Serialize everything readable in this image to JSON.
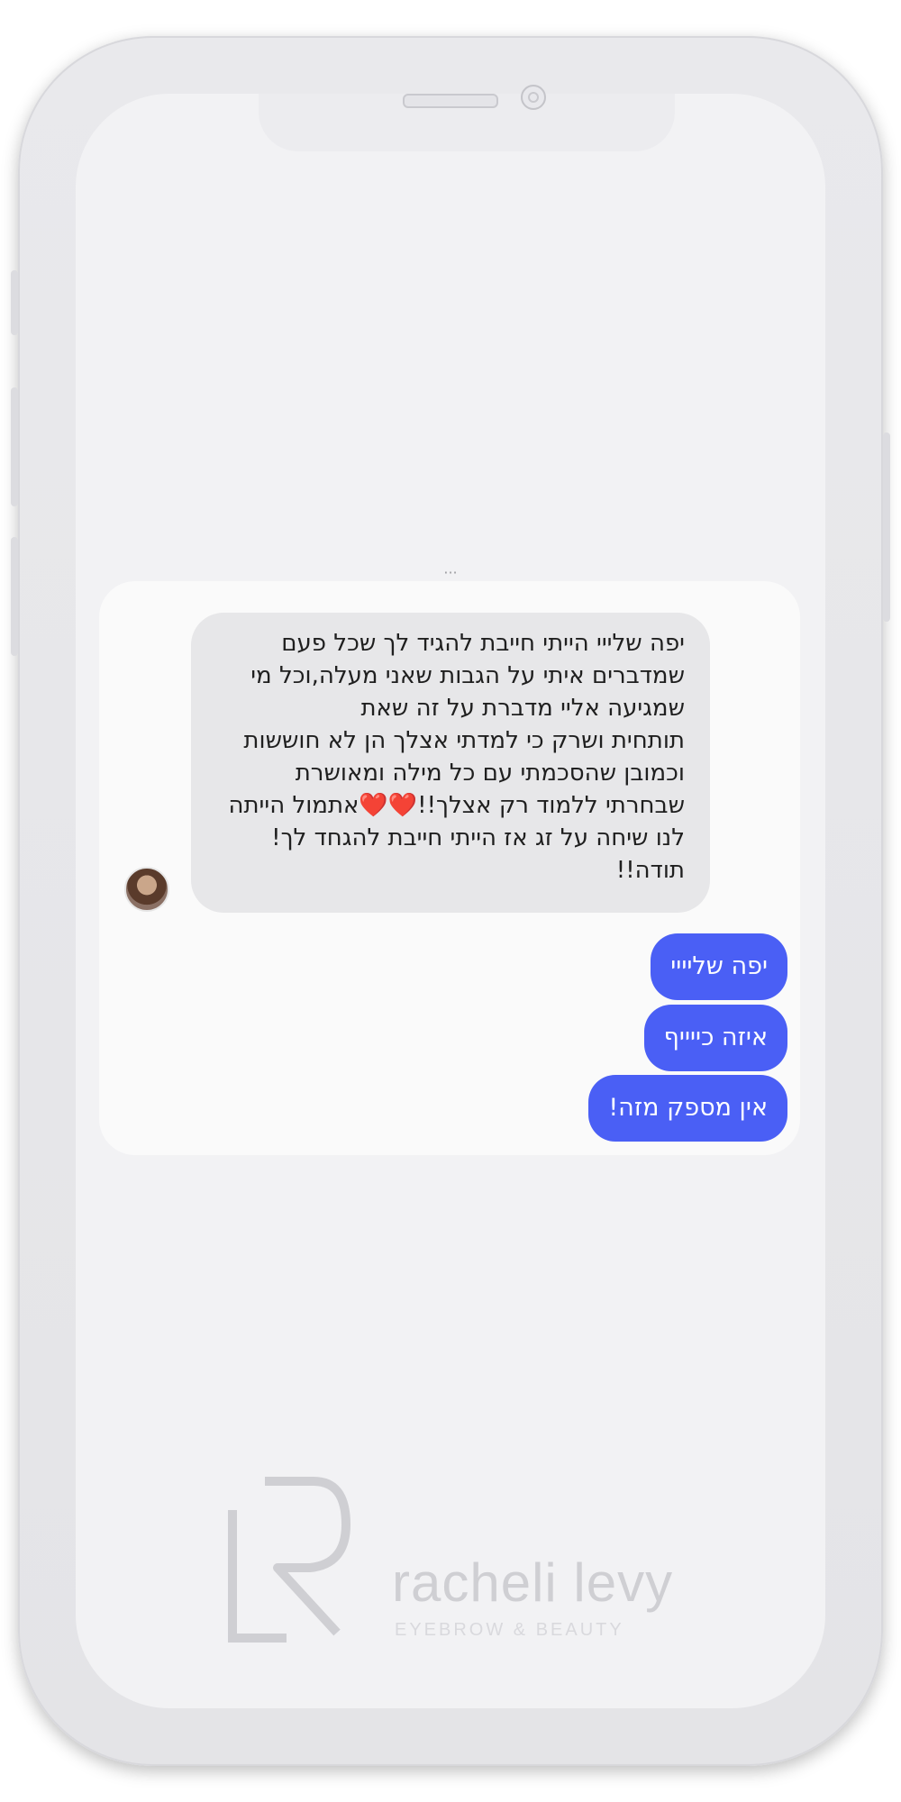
{
  "top_cut_text": "···",
  "chat": {
    "incoming": {
      "lines": [
        "יפה שלייי הייתי חייבת להגיד לך שכל פעם שמדברים איתי על הגבות שאני מעלה,וכל מי שמגיעה אליי מדברת על זה שאת",
        "תותחית ושרק כי למדתי אצלך הן לא חוששות וכמובן שהסכמתי עם כל מילה ומאושרת שבחרתי ללמוד רק אצלך!!❤️❤️אתמול הייתה לנו שיחה על זג אז הייתי חייבת להגחד לך! תודה!!"
      ]
    },
    "outgoing": [
      "יפה שליייי",
      "איזה כייייף",
      "אין מספק מזה!"
    ]
  },
  "logo": {
    "monogram": "LR",
    "name": "racheli levy",
    "tagline": "EYEBROW & BEAUTY"
  },
  "colors": {
    "outgoing_bubble": "#4a5ff5",
    "incoming_bubble": "#e7e7e9",
    "phone_frame": "#e6e6e9"
  }
}
